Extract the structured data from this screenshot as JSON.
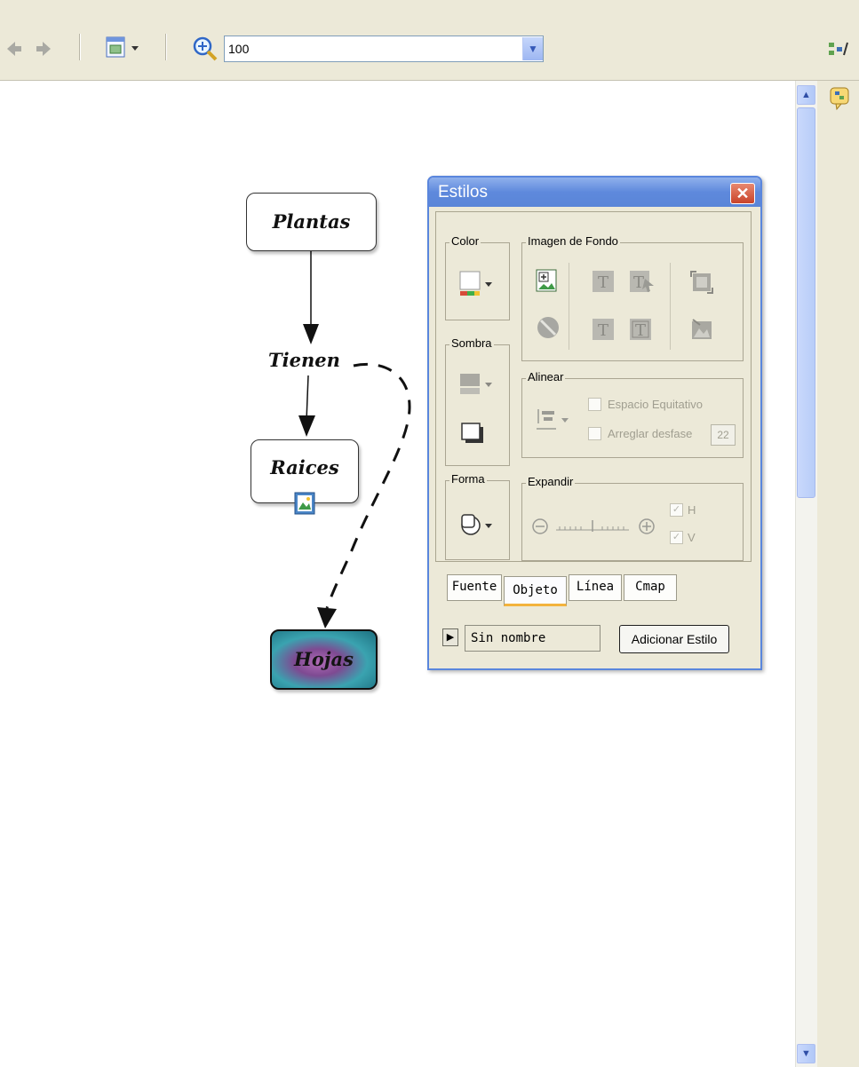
{
  "toolbar": {
    "zoom_value": "100",
    "icons": [
      "back-arrow-icon",
      "forward-arrow-icon",
      "view-menu-icon",
      "zoom-icon",
      "dropdown-arrow-icon",
      "cmap-views-icon"
    ]
  },
  "map": {
    "nodes": [
      "Plantas",
      "Raices",
      "Hojas"
    ],
    "link_label": "Tienen"
  },
  "dialog": {
    "title": "Estilos",
    "groups": {
      "color": "Color",
      "imagen_fondo": "Imagen de Fondo",
      "sombra": "Sombra",
      "alinear": "Alinear",
      "forma": "Forma",
      "expandir": "Expandir"
    },
    "alinear": {
      "espacio_equitativo": "Espacio Equitativo",
      "arreglar_desfase": "Arreglar desfase",
      "desfase_value": "22"
    },
    "expandir": {
      "h": "H",
      "v": "V"
    },
    "tabs": [
      "Fuente",
      "Objeto",
      "Línea",
      "Cmap"
    ],
    "active_tab": "Objeto",
    "style_name": "Sin nombre",
    "add_style_button": "Adicionar Estilo"
  },
  "colors": {
    "title_bar": "#5a85d8",
    "close_button": "#c9432a",
    "window_bg": "#ece9d8",
    "active_tab_underline": "#f3b33d"
  }
}
